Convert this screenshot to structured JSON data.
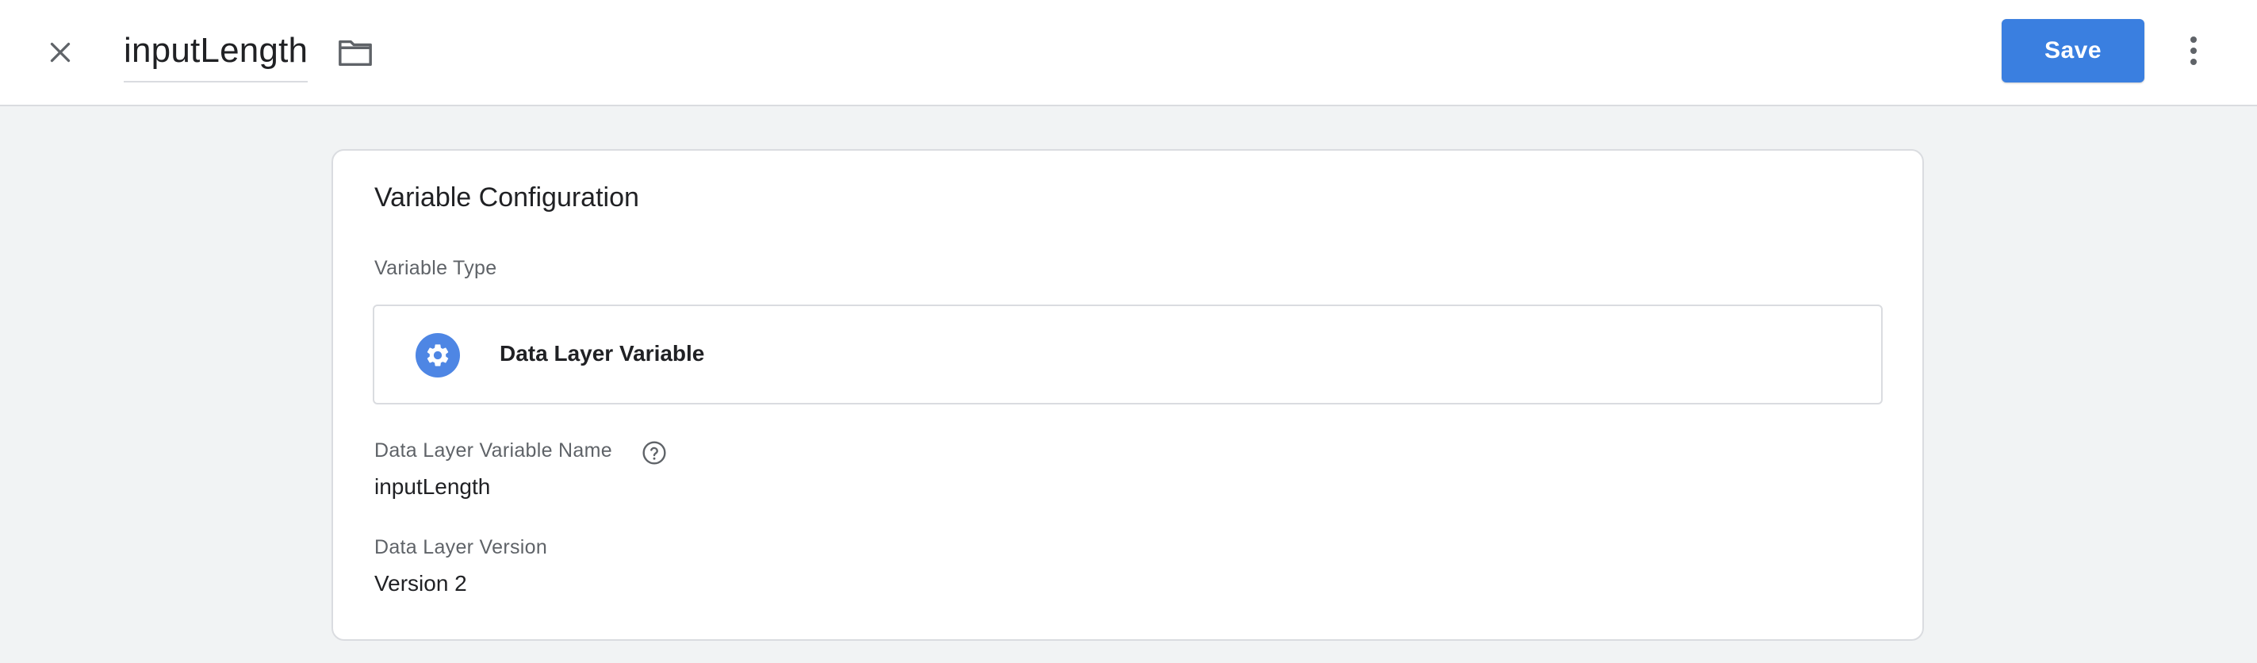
{
  "header": {
    "title": "inputLength",
    "close_icon": "close-icon",
    "folder_icon": "folder-icon",
    "save_label": "Save",
    "more_icon": "more-vert-icon",
    "accent_color": "#3a7fe0"
  },
  "card": {
    "title": "Variable Configuration",
    "variable_type_label": "Variable Type",
    "variable_type": {
      "icon": "gear-icon",
      "name": "Data Layer Variable"
    },
    "fields": [
      {
        "label": "Data Layer Variable Name",
        "value": "inputLength",
        "help_icon": "help-icon"
      },
      {
        "label": "Data Layer Version",
        "value": "Version 2"
      }
    ]
  }
}
